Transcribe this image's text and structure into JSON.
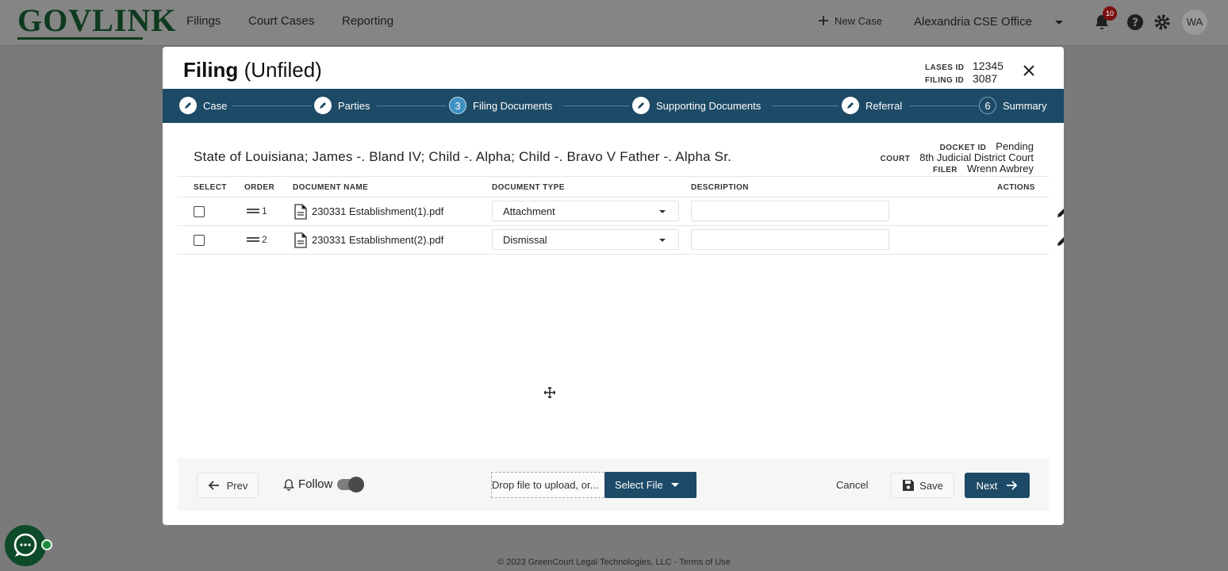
{
  "nav": {
    "logo": "GOVLINK",
    "links": [
      "Filings",
      "Court Cases",
      "Reporting"
    ],
    "new_case": "New Case",
    "office": "Alexandria CSE Office",
    "notification_count": "10",
    "avatar": "WA"
  },
  "modal": {
    "title_bold": "Filing",
    "title_rest": "(Unfiled)",
    "lases_id_label": "LASES ID",
    "lases_id": "12345",
    "filing_id_label": "FILING ID",
    "filing_id": "3087"
  },
  "steps": [
    {
      "label": "Case",
      "marker": "edit"
    },
    {
      "label": "Parties",
      "marker": "edit"
    },
    {
      "label": "Filing Documents",
      "marker": "3"
    },
    {
      "label": "Supporting Documents",
      "marker": "edit"
    },
    {
      "label": "Referral",
      "marker": "edit"
    },
    {
      "label": "Summary",
      "marker": "6"
    }
  ],
  "case": {
    "caption": "State of Louisiana; James -. Bland IV; Child -. Alpha; Child -. Bravo V Father -. Alpha Sr.",
    "docket_label": "DOCKET ID",
    "docket": "Pending",
    "court_label": "COURT",
    "court": "8th Judicial District Court",
    "filer_label": "FILER",
    "filer": "Wrenn Awbrey"
  },
  "table": {
    "headers": {
      "select": "SELECT",
      "order": "ORDER",
      "name": "DOCUMENT NAME",
      "type": "DOCUMENT TYPE",
      "description": "DESCRIPTION",
      "actions": "ACTIONS"
    },
    "rows": [
      {
        "order": "1",
        "name": "230331 Establishment(1).pdf",
        "type": "Attachment",
        "description": ""
      },
      {
        "order": "2",
        "name": "230331 Establishment(2).pdf",
        "type": "Dismissal",
        "description": ""
      }
    ]
  },
  "footer": {
    "prev": "Prev",
    "follow": "Follow",
    "drop_text": "Drop file to upload, or...",
    "select_file": "Select File",
    "cancel": "Cancel",
    "save": "Save",
    "next": "Next"
  },
  "copyright": "© 2023 GreenCourt Legal Technologies, LLC - Terms of Use",
  "colors": {
    "primary": "#1d4a66",
    "overlay": "#7a7a7a",
    "brand_green": "#0d3a1e",
    "badge": "#7a1010"
  }
}
